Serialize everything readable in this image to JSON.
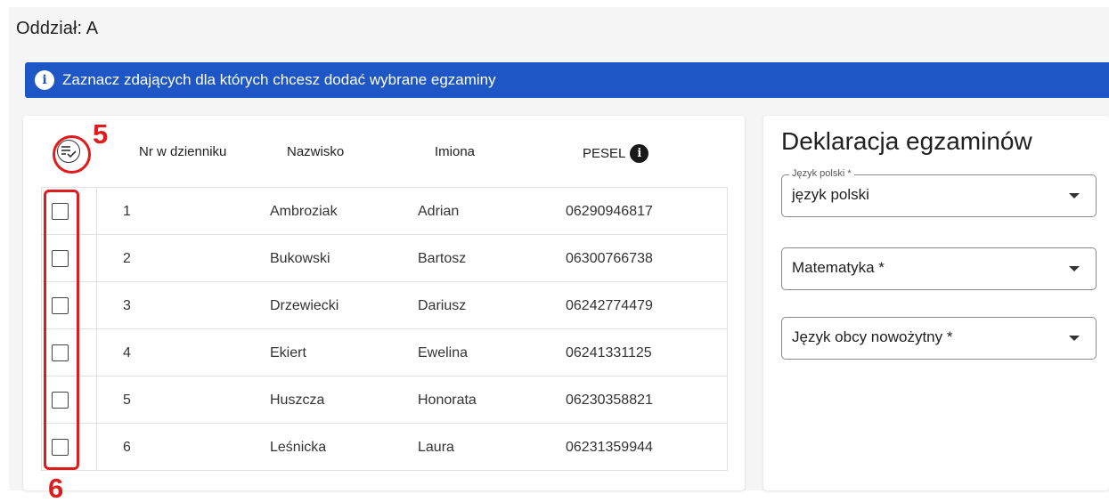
{
  "section_title": "Oddział: A",
  "info_bar": {
    "text": "Zaznacz zdających dla których chcesz dodać wybrane egzaminy",
    "icon": "info-icon",
    "color": "#1e56c6"
  },
  "table": {
    "select_all_icon": "checklist-icon",
    "headers": {
      "nr": "Nr w dzienniku",
      "nazwisko": "Nazwisko",
      "imiona": "Imiona",
      "pesel": "PESEL"
    },
    "rows": [
      {
        "nr": "1",
        "nazwisko": "Ambroziak",
        "imiona": "Adrian",
        "pesel": "06290946817"
      },
      {
        "nr": "2",
        "nazwisko": "Bukowski",
        "imiona": "Bartosz",
        "pesel": "06300766738"
      },
      {
        "nr": "3",
        "nazwisko": "Drzewiecki",
        "imiona": "Dariusz",
        "pesel": "06242774479"
      },
      {
        "nr": "4",
        "nazwisko": "Ekiert",
        "imiona": "Ewelina",
        "pesel": "06241331125"
      },
      {
        "nr": "5",
        "nazwisko": "Huszcza",
        "imiona": "Honorata",
        "pesel": "06230358821"
      },
      {
        "nr": "6",
        "nazwisko": "Leśnicka",
        "imiona": "Laura",
        "pesel": "06231359944"
      }
    ]
  },
  "annotations": {
    "label_5": "5",
    "label_6": "6",
    "color": "#e01b1b"
  },
  "declaration": {
    "title": "Deklaracja egzaminów",
    "fields": [
      {
        "legend": "Język polski *",
        "value": "język polski"
      },
      {
        "legend": "",
        "value": "Matematyka *"
      },
      {
        "legend": "",
        "value": "Język obcy nowożytny *"
      }
    ]
  }
}
